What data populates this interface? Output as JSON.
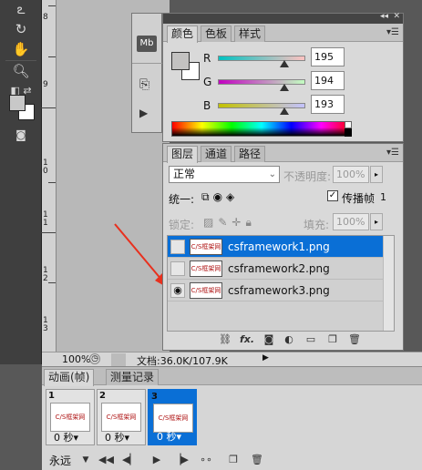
{
  "toolbar": {
    "tools": [
      "lasso-icon",
      "rotate-icon",
      "hand-icon",
      "zoom-icon",
      "swap-colors-icon",
      "quick-mask-icon"
    ]
  },
  "ruler": {
    "labels": [
      "8",
      "9",
      "1\n0",
      "1\n1",
      "1\n2",
      "1\n3"
    ]
  },
  "status": {
    "zoom": "100%",
    "doc_info": "文档:36.0K/107.9K"
  },
  "side_icons": {
    "mb": "Mb"
  },
  "color_panel": {
    "tabs": [
      "颜色",
      "色板",
      "样式"
    ],
    "r_label": "R",
    "g_label": "G",
    "b_label": "B",
    "r_value": "195",
    "g_value": "194",
    "b_value": "193",
    "r_level": 0.765,
    "g_level": 0.761,
    "b_level": 0.757,
    "fg_color": "#c3c2c1",
    "bg_color": "#ffffff"
  },
  "layers_panel": {
    "tabs": [
      "图层",
      "通道",
      "路径"
    ],
    "blend_mode": "正常",
    "opacity_label": "不透明度:",
    "opacity_value": "100%",
    "unify_label": "统一:",
    "propagate_label": "传播帧",
    "propagate_value": "1",
    "lock_label": "锁定:",
    "fill_label": "填充:",
    "fill_value": "100%",
    "layers": [
      {
        "name": "csframework1.png",
        "thumb": "C/S框架网",
        "visible": false,
        "selected": true
      },
      {
        "name": "csframework2.png",
        "thumb": "C/S框架网",
        "visible": false,
        "selected": false
      },
      {
        "name": "csframework3.png",
        "thumb": "C/S框架网",
        "visible": true,
        "selected": false
      }
    ],
    "footer_fx": "fx."
  },
  "animation_panel": {
    "tabs": [
      "动画(帧)",
      "测量记录"
    ],
    "frames": [
      {
        "num": "1",
        "thumb": "C/S框架网",
        "time": "0 秒▾"
      },
      {
        "num": "2",
        "thumb": "C/S框架网",
        "time": "0 秒▾"
      },
      {
        "num": "3",
        "thumb": "C/S框架网",
        "time": "0 秒▾"
      }
    ],
    "loop": "永远"
  },
  "colors": {
    "selection": "#0a6fd6",
    "arrow": "#e8301e"
  }
}
